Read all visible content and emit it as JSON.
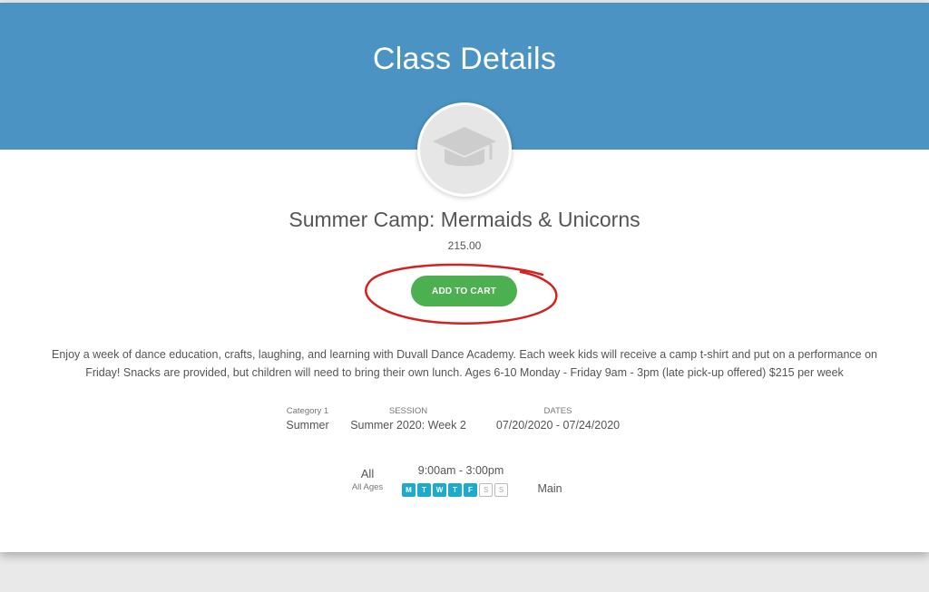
{
  "header": {
    "title": "Class Details"
  },
  "class": {
    "icon": "graduation-cap-icon",
    "title": "Summer Camp: Mermaids & Unicorns",
    "price": "215.00",
    "add_to_cart_label": "ADD TO CART",
    "description_line1": "Enjoy a week of dance education, crafts, laughing, and learning with Duvall Dance Academy. Each week kids will receive a camp t-shirt and put on a performance on",
    "description_line2": "Friday! Snacks are provided, but children will need to bring their own lunch. Ages 6-10 Monday - Friday 9am - 3pm (late pick-up offered) $215 per week"
  },
  "details": {
    "category": {
      "label": "Category 1",
      "value": "Summer"
    },
    "session": {
      "label": "SESSION",
      "value": "Summer 2020: Week 2"
    },
    "dates": {
      "label": "DATES",
      "value": "07/20/2020 - 07/24/2020"
    }
  },
  "schedule": {
    "ages": "All",
    "ages_sub": "All Ages",
    "time": "9:00am - 3:00pm",
    "days": [
      {
        "letter": "M",
        "active": true
      },
      {
        "letter": "T",
        "active": true
      },
      {
        "letter": "W",
        "active": true
      },
      {
        "letter": "T",
        "active": true
      },
      {
        "letter": "F",
        "active": true
      },
      {
        "letter": "S",
        "active": false
      },
      {
        "letter": "S",
        "active": false
      }
    ],
    "location": "Main"
  },
  "colors": {
    "header": "#4a93c2",
    "button": "#4caf50",
    "day_active": "#1eaacc",
    "annotation": "#d32222"
  }
}
